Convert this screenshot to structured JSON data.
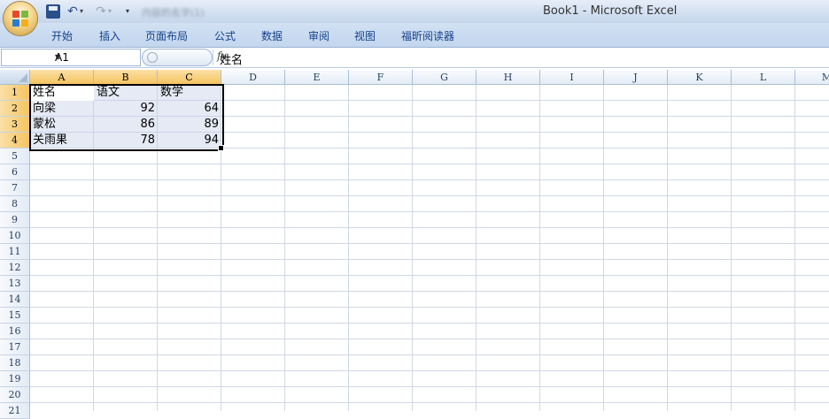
{
  "window": {
    "title": "Book1 - Microsoft Excel",
    "qat_blurred_text": "内容的名字(1)"
  },
  "ribbon": {
    "tabs": [
      "开始",
      "插入",
      "页面布局",
      "公式",
      "数据",
      "审阅",
      "视图",
      "福昕阅读器"
    ]
  },
  "formula_bar": {
    "name_box": "A1",
    "fx": "fx",
    "content": "姓名"
  },
  "sheet": {
    "columns": [
      "A",
      "B",
      "C",
      "D",
      "E",
      "F",
      "G",
      "H",
      "I",
      "J",
      "K",
      "L",
      "M"
    ],
    "rows": [
      "1",
      "2",
      "3",
      "4",
      "5",
      "6",
      "7",
      "8",
      "9",
      "10",
      "11",
      "12",
      "13",
      "14",
      "15",
      "16",
      "17",
      "18",
      "19",
      "20",
      "21"
    ],
    "selected_columns": [
      "A",
      "B",
      "C"
    ],
    "selected_rows": [
      "1",
      "2",
      "3",
      "4"
    ],
    "cells": [
      [
        "姓名",
        "语文",
        "数学"
      ],
      [
        "向梁",
        "92",
        "64"
      ],
      [
        "蒙松",
        "86",
        "89"
      ],
      [
        "关雨果",
        "78",
        "94"
      ]
    ]
  },
  "colors": {
    "ribbon": "#c9dbf1",
    "selected_header": "#f7c96a",
    "selection_tint": "#d6ddf0",
    "grid": "#d0d7e5"
  }
}
